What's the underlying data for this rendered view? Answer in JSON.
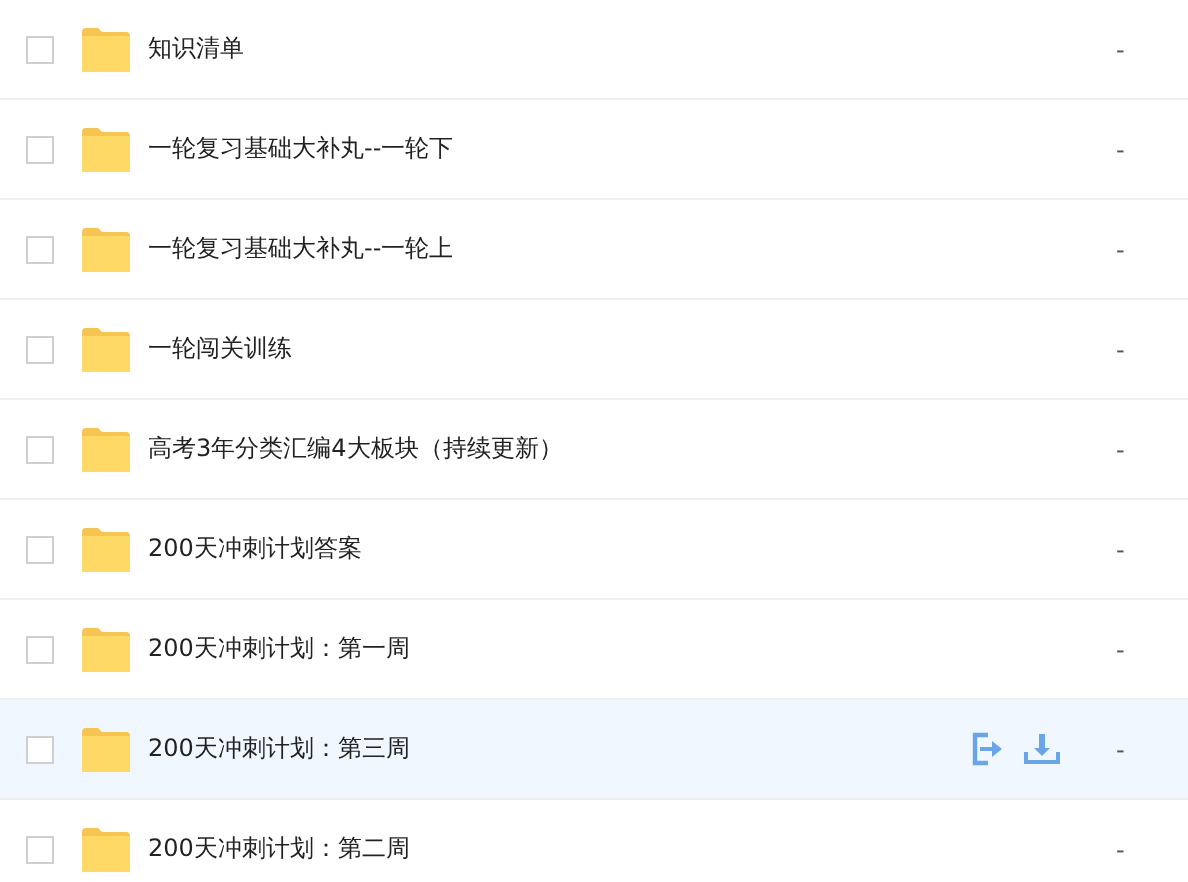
{
  "files": [
    {
      "name": "知识清单",
      "size": "-",
      "highlighted": false,
      "checked": false
    },
    {
      "name": "一轮复习基础大补丸--一轮下",
      "size": "-",
      "highlighted": false,
      "checked": false
    },
    {
      "name": "一轮复习基础大补丸--一轮上",
      "size": "-",
      "highlighted": false,
      "checked": false
    },
    {
      "name": "一轮闯关训练",
      "size": "-",
      "highlighted": false,
      "checked": false
    },
    {
      "name": "高考3年分类汇编4大板块（持续更新）",
      "size": "-",
      "highlighted": false,
      "checked": false
    },
    {
      "name": "200天冲刺计划答案",
      "size": "-",
      "highlighted": false,
      "checked": false
    },
    {
      "name": "200天冲刺计划：第一周",
      "size": "-",
      "highlighted": false,
      "checked": false
    },
    {
      "name": "200天冲刺计划：第三周",
      "size": "-",
      "highlighted": true,
      "checked": false
    },
    {
      "name": "200天冲刺计划：第二周",
      "size": "-",
      "highlighted": false,
      "checked": false
    }
  ]
}
